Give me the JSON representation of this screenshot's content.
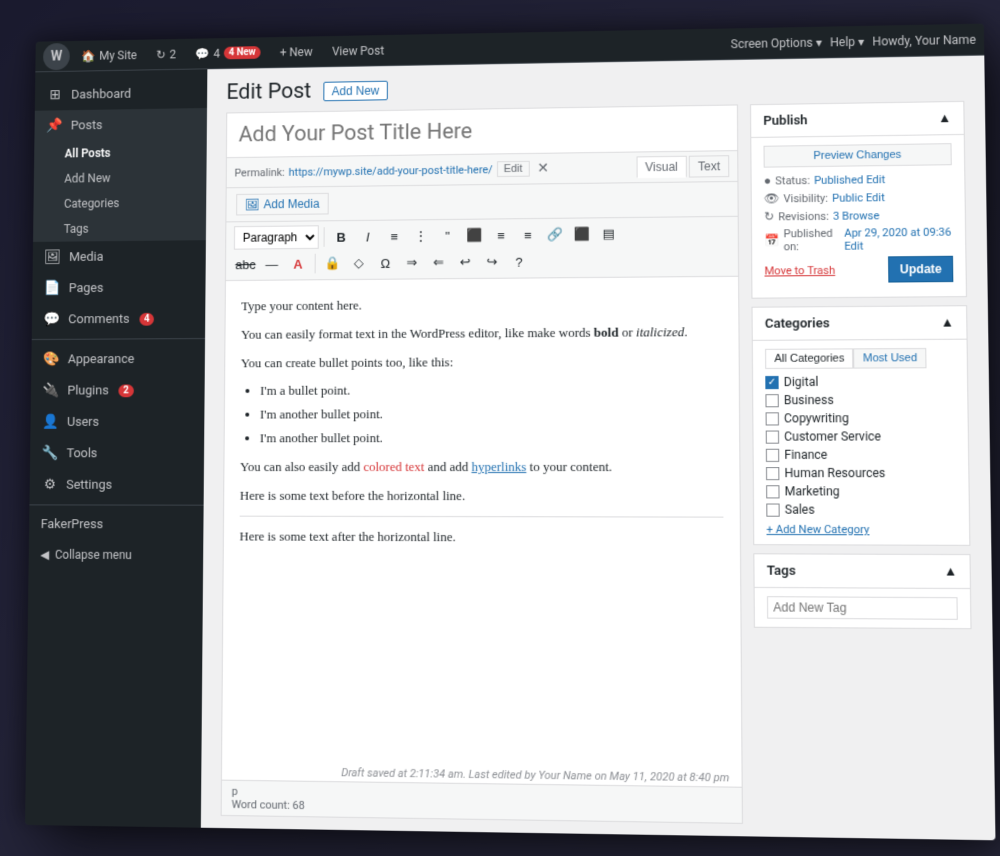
{
  "adminBar": {
    "wpLogo": "W",
    "mySite": "My Site",
    "updates": "2",
    "comments": "4",
    "newLabel": "+ New",
    "viewPost": "View Post",
    "screenOptions": "Screen Options ▾",
    "help": "Help ▾",
    "howdy": "Howdy, Your Name"
  },
  "sidebar": {
    "dashboard": "Dashboard",
    "posts": "Posts",
    "allPosts": "All Posts",
    "addNew": "Add New",
    "categories": "Categories",
    "tags": "Tags",
    "media": "Media",
    "pages": "Pages",
    "comments": "Comments",
    "commentsBadge": "4",
    "appearance": "Appearance",
    "plugins": "Plugins",
    "pluginsBadge": "2",
    "users": "Users",
    "tools": "Tools",
    "settings": "Settings",
    "fakerPress": "FakerPress",
    "collapseMenu": "Collapse menu"
  },
  "pageHeader": {
    "title": "Edit Post",
    "addNew": "Add New"
  },
  "editor": {
    "titlePlaceholder": "Add Your Post Title Here",
    "permalinkLabel": "Permalink:",
    "permalinkUrl": "https://mywp.site/add-your-post-title-here/",
    "editBtn": "Edit",
    "visualTab": "Visual",
    "textTab": "Text",
    "addMediaBtn": "Add Media",
    "paragraphSelect": "Paragraph",
    "content": {
      "line1": "Type your content here.",
      "line2": "You can easily format text in the WordPress editor, like make words bold or italicized.",
      "line3": "You can create bullet points too, like this:",
      "bullet1": "I'm a bullet point.",
      "bullet2": "I'm another bullet point.",
      "bullet3": "I'm another bullet point.",
      "line4": "You can also easily add colored text and add hyperlinks to your content.",
      "line5": "Here is some text before the horizontal line.",
      "line6": "Here is some text after the horizontal line."
    },
    "draftSaved": "Draft saved at 2:11:34 am. Last edited by Your Name on May 11, 2020 at 8:40 pm",
    "wordCountLabel": "p",
    "wordCount": "Word count: 68"
  },
  "publish": {
    "title": "Publish",
    "previewBtn": "Preview Changes",
    "statusLabel": "Status:",
    "statusValue": "Published Edit",
    "visibilityLabel": "Visibility:",
    "visibilityValue": "Public Edit",
    "revisionsLabel": "Revisions:",
    "revisionsValue": "3 Browse",
    "publishedLabel": "Published on:",
    "publishedValue": "Apr 29, 2020 at 09:36 Edit",
    "moveToTrash": "Move to Trash",
    "updateBtn": "Update"
  },
  "categories": {
    "title": "Categories",
    "allTab": "All Categories",
    "mostUsed": "Most Used",
    "items": [
      {
        "label": "Digital",
        "checked": true
      },
      {
        "label": "Business",
        "checked": false
      },
      {
        "label": "Copywriting",
        "checked": false
      },
      {
        "label": "Customer Service",
        "checked": false
      },
      {
        "label": "Finance",
        "checked": false
      },
      {
        "label": "Human Resources",
        "checked": false
      },
      {
        "label": "Marketing",
        "checked": false
      },
      {
        "label": "Sales",
        "checked": false
      }
    ],
    "addNewCategory": "+ Add New Category"
  },
  "tags": {
    "title": "Tags",
    "placeholder": "Add New Tag"
  }
}
